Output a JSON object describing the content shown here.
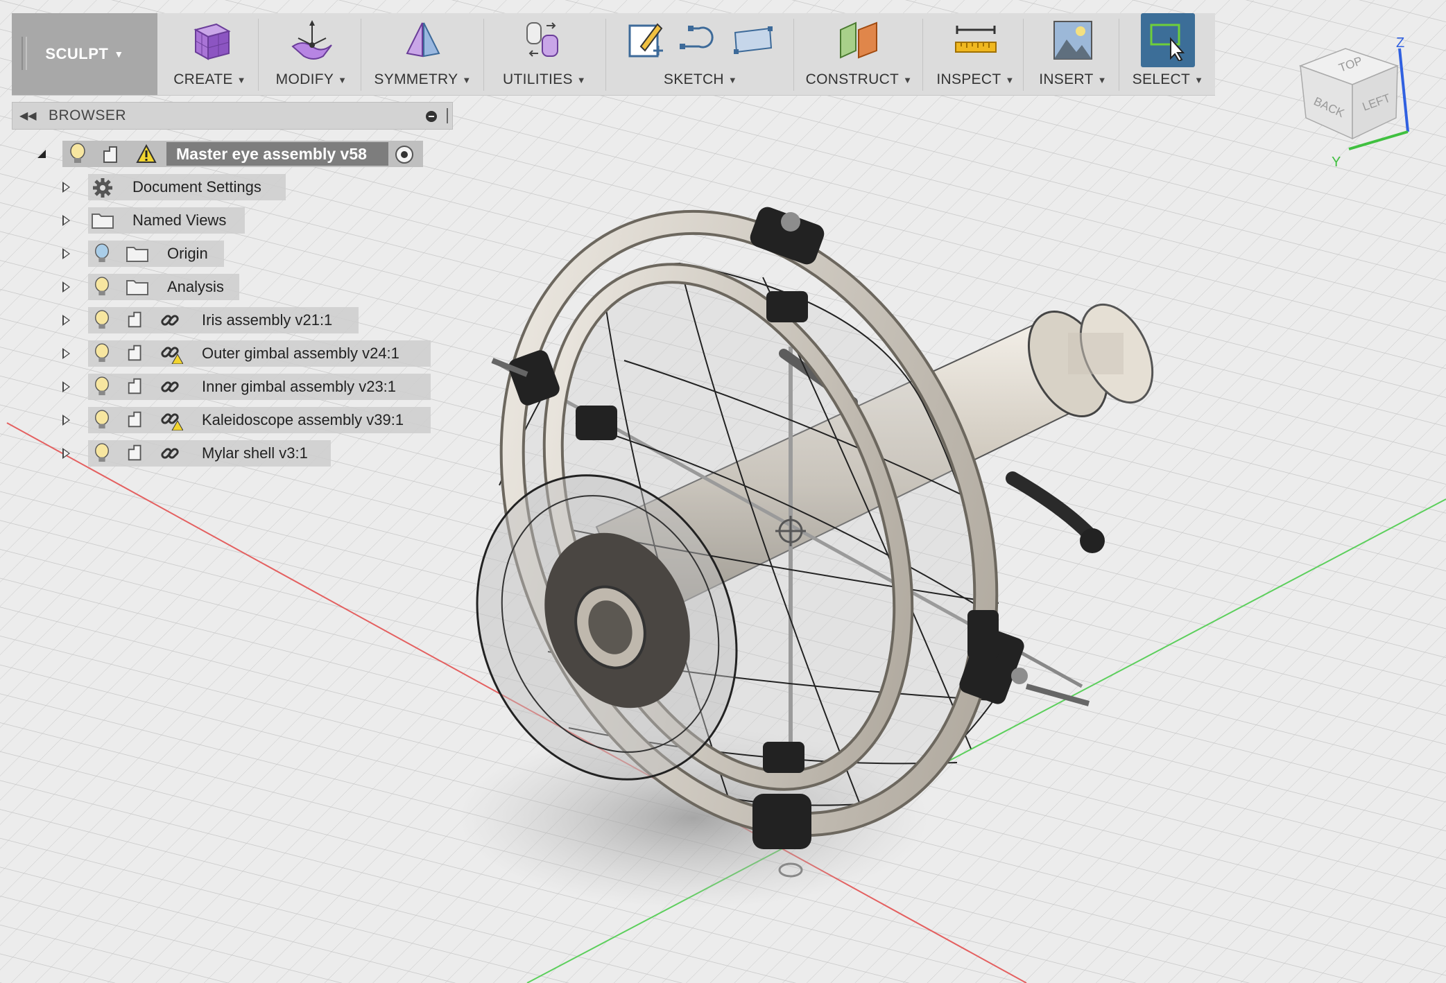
{
  "toolbar": {
    "workspace": "SCULPT",
    "groups": [
      {
        "label": "CREATE"
      },
      {
        "label": "MODIFY"
      },
      {
        "label": "SYMMETRY"
      },
      {
        "label": "UTILITIES"
      },
      {
        "label": "SKETCH"
      },
      {
        "label": "CONSTRUCT"
      },
      {
        "label": "INSPECT"
      },
      {
        "label": "INSERT"
      },
      {
        "label": "SELECT"
      }
    ]
  },
  "browser": {
    "title": "BROWSER",
    "root": "Master eye assembly v58",
    "items": [
      {
        "label": "Document Settings",
        "icon": "gear-icon"
      },
      {
        "label": "Named Views",
        "icon": "folder-icon"
      },
      {
        "label": "Origin",
        "icon": "folder-icon"
      },
      {
        "label": "Analysis",
        "icon": "folder-icon"
      },
      {
        "label": "Iris assembly v21:1",
        "icon": "link-icon"
      },
      {
        "label": "Outer gimbal assembly v24:1",
        "icon": "link-warning-icon"
      },
      {
        "label": "Inner gimbal assembly v23:1",
        "icon": "link-icon"
      },
      {
        "label": "Kaleidoscope assembly v39:1",
        "icon": "link-warning-icon"
      },
      {
        "label": "Mylar shell v3:1",
        "icon": "link-icon"
      }
    ]
  },
  "viewcube": {
    "faces": [
      "TOP",
      "BACK",
      "LEFT"
    ],
    "axes": [
      "Z",
      "Y"
    ]
  },
  "colors": {
    "toolbar_bg": "#dcdcdc",
    "select_active": "#3c6e98",
    "axis_x": "#e05050",
    "axis_y": "#40c040",
    "axis_z": "#3060e0"
  }
}
